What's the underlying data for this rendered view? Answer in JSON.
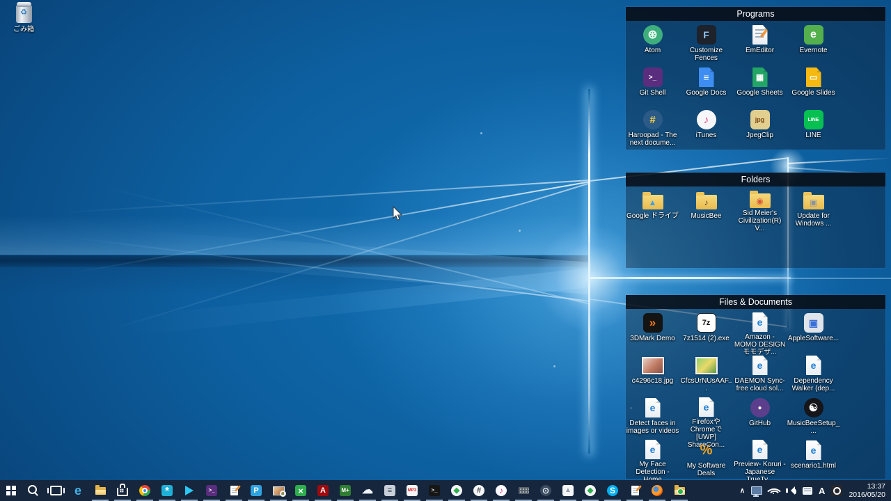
{
  "desktop": {
    "recycle_bin_label": "ごみ箱"
  },
  "fences": [
    {
      "title": "Programs",
      "items": [
        {
          "name": "atom",
          "label": "Atom",
          "kind": "circ",
          "bg": "#3fae7d",
          "fg": "#eafff3",
          "glyph": "⊛",
          "fs": 17
        },
        {
          "name": "customize-fences",
          "label": "Customize Fences",
          "kind": "sq",
          "bg": "#1e222b",
          "fg": "#8fc3ef",
          "glyph": "F",
          "fs": 14
        },
        {
          "name": "emeditor",
          "label": "EmEditor",
          "kind": "page",
          "glyph": "",
          "pencil": true,
          "lines": true
        },
        {
          "name": "evernote",
          "label": "Evernote",
          "kind": "sq",
          "bg": "#53b04c",
          "fg": "#ffffff",
          "glyph": "e",
          "fs": 16
        },
        {
          "name": "git-shell",
          "label": "Git Shell",
          "kind": "sq",
          "bg": "#5a2d7e",
          "fg": "#ffffff",
          "glyph": ">_",
          "fs": 10
        },
        {
          "name": "google-docs",
          "label": "Google Docs",
          "kind": "pagec",
          "bg": "#3e8df3",
          "fg": "#ffffff",
          "glyph": "≡",
          "fs": 14
        },
        {
          "name": "google-sheets",
          "label": "Google Sheets",
          "kind": "pagec",
          "bg": "#23a566",
          "fg": "#ffffff",
          "glyph": "▦",
          "fs": 12
        },
        {
          "name": "google-slides",
          "label": "Google Slides",
          "kind": "pagec",
          "bg": "#f5b912",
          "fg": "#ffffff",
          "glyph": "▭",
          "fs": 12
        },
        {
          "name": "haroopad",
          "label": "Haroopad - The next docume...",
          "kind": "circ",
          "bg": "#2c5a86",
          "fg": "#f2d24a",
          "glyph": "#",
          "fs": 15
        },
        {
          "name": "itunes",
          "label": "iTunes",
          "kind": "circ",
          "bg": "#f7f7fa",
          "fg": "#e0457d",
          "glyph": "♪",
          "fs": 15
        },
        {
          "name": "jpegclip",
          "label": "JpegClip",
          "kind": "sq",
          "bg": "#e2cf8f",
          "fg": "#7a4616",
          "glyph": "jpg",
          "fs": 9
        },
        {
          "name": "line",
          "label": "LINE",
          "kind": "sq",
          "bg": "#06c152",
          "fg": "#ffffff",
          "glyph": "LINE",
          "fs": 7
        }
      ]
    },
    {
      "title": "Folders",
      "items": [
        {
          "name": "google-drive-folder",
          "label": "Google ドライブ",
          "kind": "folder",
          "glyph": "▲",
          "fg": "#3aa0e8"
        },
        {
          "name": "musicbee-folder",
          "label": "MusicBee",
          "kind": "folder",
          "glyph": "♪",
          "fg": "#5a4430"
        },
        {
          "name": "civilization-v-folder",
          "label": "Sid Meier's Civilization(R) V...",
          "kind": "folder",
          "glyph": "◉",
          "fg": "#d85c3a"
        },
        {
          "name": "update-for-windows-folder",
          "label": "Update for Windows ...",
          "kind": "folder",
          "glyph": "▣",
          "fg": "#8a93a5"
        }
      ]
    },
    {
      "title": "Files & Documents",
      "items": [
        {
          "name": "3dmark-demo",
          "label": "3DMark Demo",
          "kind": "sq",
          "bg": "#141414",
          "fg": "#ff7a1a",
          "glyph": "»",
          "fs": 17
        },
        {
          "name": "7z-installer",
          "label": "7z1514 (2).exe",
          "kind": "sq",
          "bg": "#ffffff",
          "fg": "#111111",
          "glyph": "7z",
          "fs": 11,
          "border": "#222222"
        },
        {
          "name": "amazon-momo-html",
          "label": "Amazon - MOMO DESIGN モモデザ...",
          "kind": "page",
          "glyph": "e"
        },
        {
          "name": "apple-software-update",
          "label": "AppleSoftware...",
          "kind": "sq",
          "bg": "#dfe3ea",
          "fg": "#3a6fd8",
          "glyph": "▣",
          "fs": 14
        },
        {
          "name": "c4296c18-jpg",
          "label": "c4296c18.jpg",
          "kind": "thumb",
          "bg": "linear-gradient(135deg,#e8cfc6,#c07a62 55%,#8a5348)"
        },
        {
          "name": "cfcsurnusaaf-image",
          "label": "CfcsUrNUsAAF...",
          "kind": "thumb",
          "bg": "linear-gradient(135deg,#8fd06a,#ead96a 50%,#5a9a46)"
        },
        {
          "name": "daemon-sync-html",
          "label": "DAEMON Sync- free cloud sol...",
          "kind": "page",
          "glyph": "e"
        },
        {
          "name": "dependency-walker-html",
          "label": "Dependency Walker (dep...",
          "kind": "page",
          "glyph": "e"
        },
        {
          "name": "detect-faces-html",
          "label": "Detect faces in images or videos",
          "kind": "page",
          "glyph": "e"
        },
        {
          "name": "firefox-chrome-sharecon-html",
          "label": "FirefoxやChromeで [UWP] ShareCon...",
          "kind": "page",
          "glyph": "e"
        },
        {
          "name": "github",
          "label": "GitHub",
          "kind": "circ",
          "bg": "#5b3f8c",
          "fg": "#f0eef5",
          "glyph": "●",
          "fs": 10
        },
        {
          "name": "musicbee-setup",
          "label": "MusicBeeSetup_...",
          "kind": "circ",
          "bg": "#15151a",
          "fg": "#ffffff",
          "glyph": "☯",
          "fs": 15
        },
        {
          "name": "my-face-detection-html",
          "label": "My Face Detection - Home",
          "kind": "page",
          "glyph": "e"
        },
        {
          "name": "my-software-deals",
          "label": "My Software Deals",
          "kind": "sq",
          "bg": "transparent",
          "fg": "#f5a51d",
          "glyph": "%",
          "fs": 20
        },
        {
          "name": "preview-koruri-html",
          "label": "Preview- Koruri - Japanese TrueTy...",
          "kind": "page",
          "glyph": "e"
        },
        {
          "name": "scenario1-html",
          "label": "scenario1.html",
          "kind": "page",
          "glyph": "e"
        }
      ]
    }
  ],
  "taskbar": {
    "items": [
      {
        "name": "start-button",
        "kind": "win"
      },
      {
        "name": "search-button",
        "kind": "search"
      },
      {
        "name": "task-view-button",
        "kind": "taskview"
      },
      {
        "name": "edge",
        "kind": "glyph",
        "glyph": "e",
        "fg": "#41b4ea",
        "fs": 18
      },
      {
        "name": "file-explorer",
        "kind": "folder",
        "running": true
      },
      {
        "name": "windows-store",
        "kind": "store",
        "running": true
      },
      {
        "name": "chrome",
        "kind": "chrome",
        "running": true
      },
      {
        "name": "photoscape",
        "kind": "glyph",
        "glyph": "*",
        "bg": "#1fb0d8",
        "fg": "#ffffff",
        "fs": 15,
        "shape": "sq",
        "running": true
      },
      {
        "name": "google-play",
        "kind": "tri",
        "running": true
      },
      {
        "name": "git-shell",
        "kind": "glyph",
        "glyph": ">_",
        "bg": "#5a2d7e",
        "fg": "#ffffff",
        "fs": 8,
        "shape": "sq",
        "running": true
      },
      {
        "name": "emeditor",
        "kind": "page",
        "running": true
      },
      {
        "name": "pocket-app",
        "kind": "glyph",
        "glyph": "P",
        "bg": "#2fa3e0",
        "fg": "#ffffff",
        "fs": 11,
        "shape": "sq",
        "running": true
      },
      {
        "name": "photo-viewer",
        "kind": "photo",
        "running": true
      },
      {
        "name": "green-x-app",
        "kind": "glyph",
        "glyph": "×",
        "bg": "#2fae4e",
        "fg": "#ffffff",
        "fs": 13,
        "shape": "sq",
        "running": true
      },
      {
        "name": "adobe-reader",
        "kind": "glyph",
        "glyph": "A",
        "bg": "#9e0b0f",
        "fg": "#ffffff",
        "fs": 11,
        "shape": "sq",
        "running": true
      },
      {
        "name": "m-plus-app",
        "kind": "glyph",
        "glyph": "M+",
        "bg": "#2e7d32",
        "fg": "#ffffff",
        "fs": 8,
        "shape": "sq",
        "running": true
      },
      {
        "name": "onedrive",
        "kind": "glyph",
        "glyph": "☁",
        "fg": "#eef4fa",
        "fs": 16,
        "running": true
      },
      {
        "name": "gray-text-tool",
        "kind": "glyph",
        "glyph": "≡",
        "bg": "#c9cfd8",
        "fg": "#3a4656",
        "fs": 11,
        "shape": "sq",
        "running": true
      },
      {
        "name": "mp3tag",
        "kind": "glyph",
        "glyph": "MP3",
        "bg": "#f4f6f8",
        "fg": "#dd2222",
        "fs": 6,
        "shape": "sq",
        "running": true
      },
      {
        "name": "command-prompt",
        "kind": "glyph",
        "glyph": ">_",
        "bg": "#161616",
        "fg": "#e8e8e8",
        "fs": 8,
        "shape": "sq",
        "running": true
      },
      {
        "name": "green-gem-app",
        "kind": "glyph",
        "glyph": "◆",
        "bg": "#f4f6f8",
        "fg": "#2fae4e",
        "fs": 11,
        "shape": "circ",
        "running": true
      },
      {
        "name": "hash-app",
        "kind": "glyph",
        "glyph": "#",
        "bg": "#f4f6f8",
        "fg": "#444444",
        "fs": 11,
        "shape": "circ",
        "running": true
      },
      {
        "name": "itunes",
        "kind": "glyph",
        "glyph": "♪",
        "bg": "#fdfdff",
        "fg": "#e0457d",
        "fs": 12,
        "shape": "circ",
        "running": true
      },
      {
        "name": "keyboard-app",
        "kind": "kbd",
        "running": true
      },
      {
        "name": "steam",
        "kind": "glyph",
        "glyph": "⊙",
        "bg": "#3b4a5c",
        "fg": "#dfe8f0",
        "fs": 12,
        "shape": "circ",
        "running": true
      },
      {
        "name": "photos-app",
        "kind": "glyph",
        "glyph": "▲",
        "bg": "#f4f6f8",
        "fg": "#98a2ae",
        "fs": 10,
        "shape": "sq",
        "running": true
      },
      {
        "name": "green-gem-app-2",
        "kind": "glyph",
        "glyph": "◆",
        "bg": "#f4f6f8",
        "fg": "#2fae4e",
        "fs": 11,
        "shape": "circ",
        "running": true
      },
      {
        "name": "skype",
        "kind": "glyph",
        "glyph": "S",
        "bg": "#00aff0",
        "fg": "#ffffff",
        "fs": 12,
        "shape": "circ",
        "running": true
      },
      {
        "name": "notepad-app",
        "kind": "page",
        "running": true
      },
      {
        "name": "firefox",
        "kind": "fox",
        "running": true
      },
      {
        "name": "app-folder",
        "kind": "folder",
        "dot": "#35b24a",
        "running": true
      }
    ],
    "tray": {
      "ime_mode": "A",
      "time": "13:37",
      "date": "2016/05/20"
    }
  }
}
